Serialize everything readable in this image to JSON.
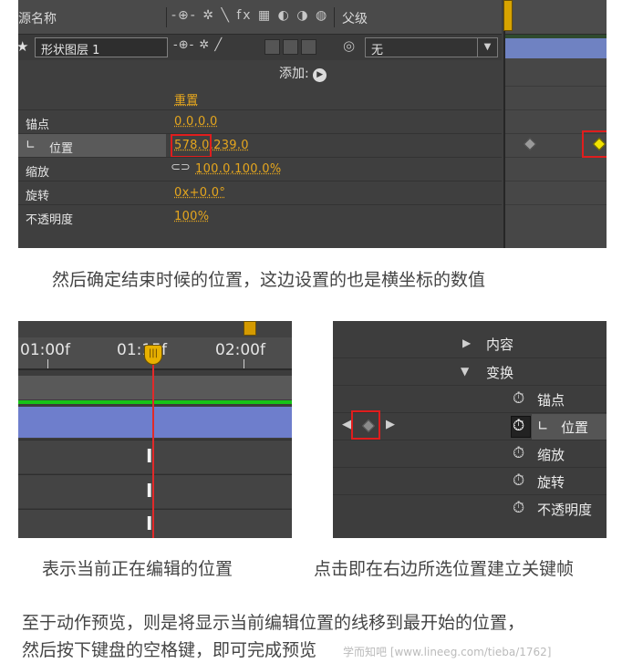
{
  "panel1": {
    "header": {
      "source_name": "源名称",
      "switch_icons": "-⊕- ✲ ╲ fx ▦ ◐ ◑ ◍",
      "parent_label": "父级"
    },
    "layer": {
      "name": "形状图层 1",
      "switch_icons": "-⊕- ✲ ╱",
      "parent_value": "无"
    },
    "add_label": "添加:",
    "props": [
      {
        "label": "",
        "value": "重置"
      },
      {
        "label": "锚点",
        "value": "0.0,0.0"
      },
      {
        "label": "位置",
        "value": "578.0,239.0"
      },
      {
        "label": "缩放",
        "value": "100.0,100.0%"
      },
      {
        "label": "旋转",
        "value": "0x+0.0°"
      },
      {
        "label": "不透明度",
        "value": "100%"
      }
    ],
    "accent_color": "#e5a61e",
    "keyframe_color": "#f2e200",
    "highlight_color": "#e01d1d"
  },
  "caption1": "然后确定结束时候的位置，这边设置的也是横坐标的数值",
  "panel2": {
    "ruler_labels": [
      "01:00f",
      "01:15f",
      "02:00f"
    ]
  },
  "panel3": {
    "rows": [
      {
        "label": "内容",
        "kind": "group-collapsed"
      },
      {
        "label": "变换",
        "kind": "group-expanded"
      },
      {
        "label": "锚点",
        "kind": "prop"
      },
      {
        "label": "位置",
        "kind": "prop-active"
      },
      {
        "label": "缩放",
        "kind": "prop"
      },
      {
        "label": "旋转",
        "kind": "prop"
      },
      {
        "label": "不透明度",
        "kind": "prop"
      }
    ]
  },
  "caption2_left": "表示当前正在编辑的位置",
  "caption2_right": "点击即在右边所选位置建立关键帧",
  "paragraph": [
    "至于动作预览，则是将显示当前编辑位置的线移到最开始的位置，",
    "然后按下键盘的空格键，即可完成预览"
  ],
  "watermark": "学而知吧 [www.lineeg.com/tieba/1762]"
}
